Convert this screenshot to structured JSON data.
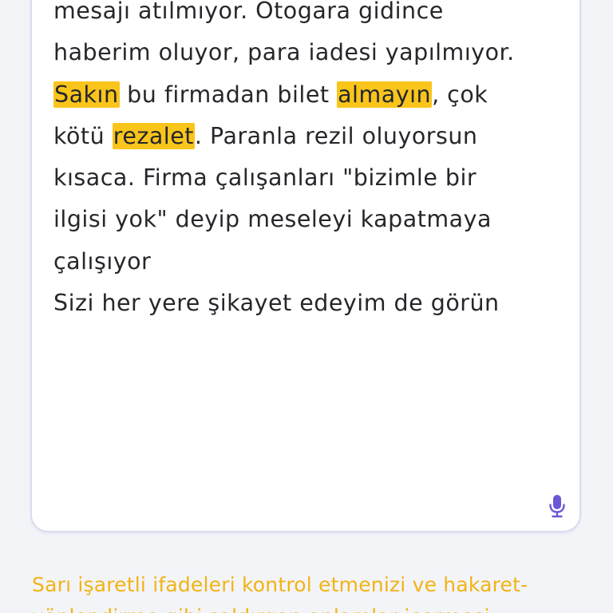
{
  "complaint": {
    "lines": [
      {
        "segments": [
          {
            "text": "mesajı atılmıyor. Otogara gidince",
            "highlight": false
          }
        ]
      },
      {
        "segments": [
          {
            "text": "haberim oluyor, para iadesi yapılmıyor.",
            "highlight": false
          }
        ]
      },
      {
        "segments": [
          {
            "text": "Sakın",
            "highlight": true
          },
          {
            "text": " bu firmadan bilet ",
            "highlight": false
          },
          {
            "text": "almayın",
            "highlight": true
          },
          {
            "text": ", çok",
            "highlight": false
          }
        ]
      },
      {
        "segments": [
          {
            "text": "kötü ",
            "highlight": false
          },
          {
            "text": "rezalet",
            "highlight": true
          },
          {
            "text": ". Paranla rezil oluyorsun",
            "highlight": false
          }
        ]
      },
      {
        "segments": [
          {
            "text": "kısaca. Firma çalışanları \"bizimle bir",
            "highlight": false
          }
        ]
      },
      {
        "segments": [
          {
            "text": "ilgisi yok\" deyip meseleyi kapatmaya",
            "highlight": false
          }
        ]
      },
      {
        "segments": [
          {
            "text": "çalışıyor",
            "highlight": false
          }
        ]
      },
      {
        "segments": [
          {
            "text": "Sizi her yere şikayet edeyim de görün",
            "highlight": false
          }
        ]
      }
    ],
    "mic_icon": "microphone-icon"
  },
  "warning": {
    "lines": [
      "Sarı işaretli ifadeleri kontrol etmenizi ve hakaret-",
      "yönlendirme gibi saldırgan anlamlar içermesi"
    ]
  },
  "colors": {
    "highlight": "#f9c51b",
    "warning_text": "#f2b315",
    "mic_icon": "#6b57d6",
    "box_border": "#d9dcef",
    "page_background": "#f3f4f8"
  }
}
